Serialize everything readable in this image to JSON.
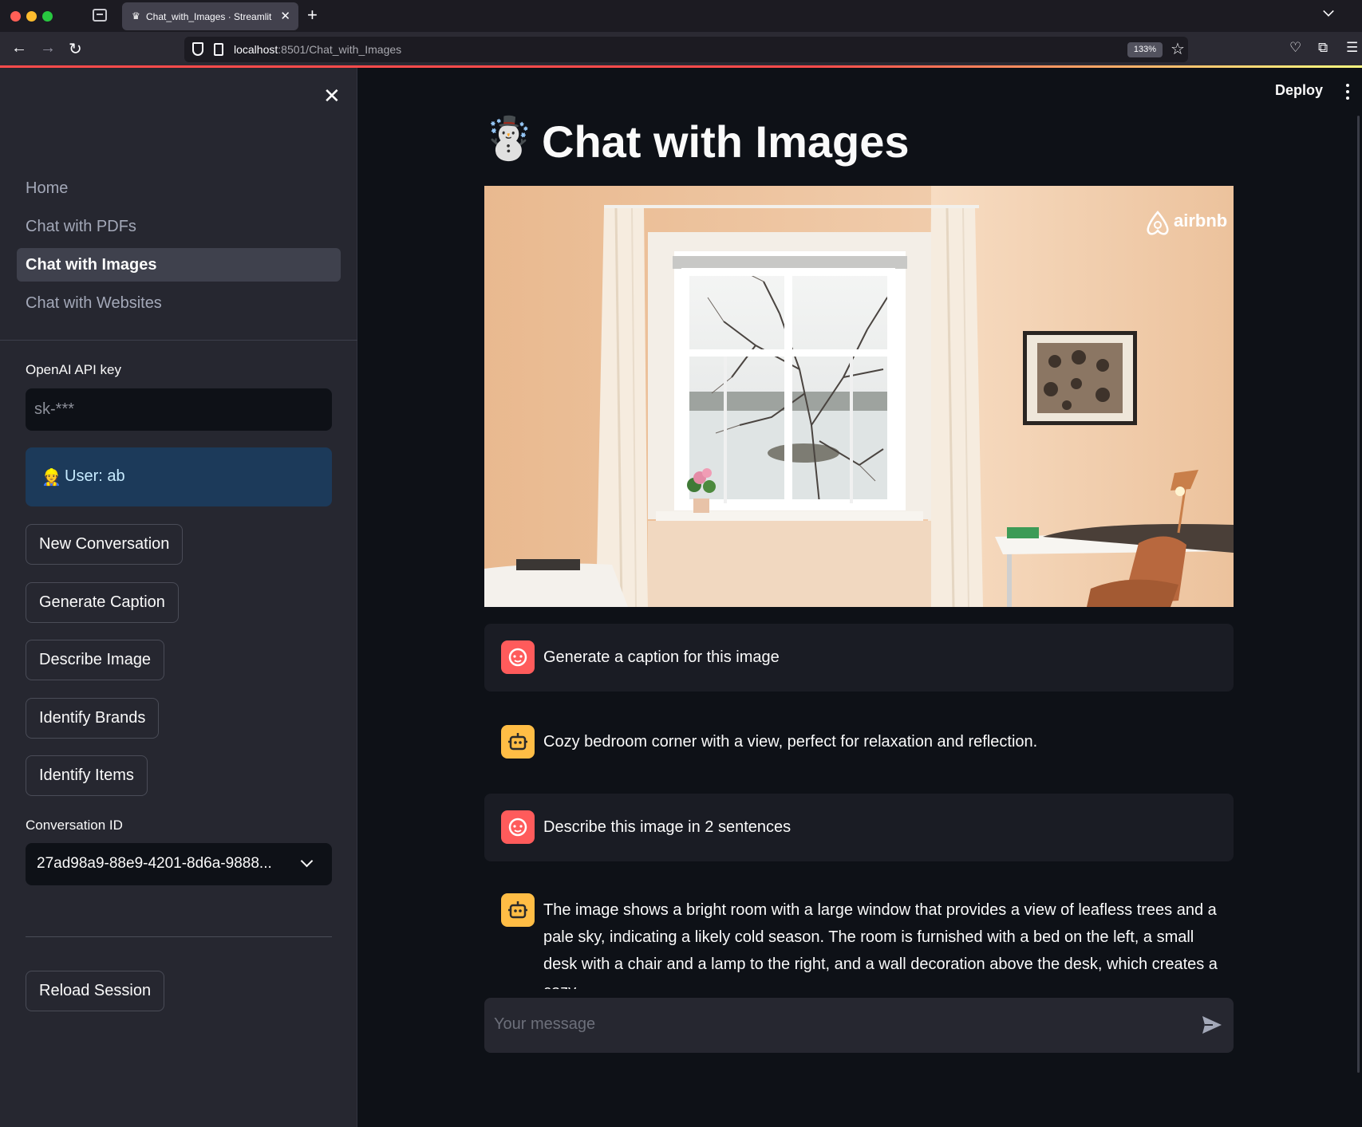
{
  "browser": {
    "tab_title": "Chat_with_Images · Streamlit",
    "tab_favicon": "streamlit-crown-icon",
    "url_host": "localhost",
    "url_path": ":8501/Chat_with_Images",
    "zoom": "133%"
  },
  "sidebar": {
    "nav_items": [
      {
        "label": "Home",
        "active": false
      },
      {
        "label": "Chat with PDFs",
        "active": false
      },
      {
        "label": "Chat with Images",
        "active": true
      },
      {
        "label": "Chat with Websites",
        "active": false
      }
    ],
    "api_key_label": "OpenAI API key",
    "api_key_value": "sk-***",
    "user_emoji": "👷",
    "user_text": "User: ab",
    "buttons": {
      "new_conversation": "New Conversation",
      "generate_caption": "Generate Caption",
      "describe_image": "Describe Image",
      "identify_brands": "Identify Brands",
      "identify_items": "Identify Items",
      "reload_session": "Reload Session"
    },
    "conversation_id_label": "Conversation ID",
    "conversation_id_value": "27ad98a9-88e9-4201-8d6a-9888..."
  },
  "header": {
    "deploy_label": "Deploy"
  },
  "main": {
    "title_emoji": "☃️",
    "title": "Chat with Images",
    "image_watermark": "airbnb",
    "messages": [
      {
        "role": "user",
        "text": "Generate a caption for this image"
      },
      {
        "role": "assistant",
        "text": "Cozy bedroom corner with a view, perfect for relaxation and reflection."
      },
      {
        "role": "user",
        "text": "Describe this image in 2 sentences"
      },
      {
        "role": "assistant",
        "text": "The image shows a bright room with a large window that provides a view of leafless trees and a pale sky, indicating a likely cold season. The room is furnished with a bed on the left, a small desk with a chair and a lamp to the right, and a wall decoration above the desk, which creates a cozy"
      }
    ],
    "chat_placeholder": "Your message"
  },
  "colors": {
    "background": "#0e1117",
    "sidebar": "#262730",
    "accent": "#ff4b4b",
    "user_avatar": "#ff5b5b",
    "assistant_avatar": "#ffbd45",
    "info_box": "#1c3a5a"
  }
}
